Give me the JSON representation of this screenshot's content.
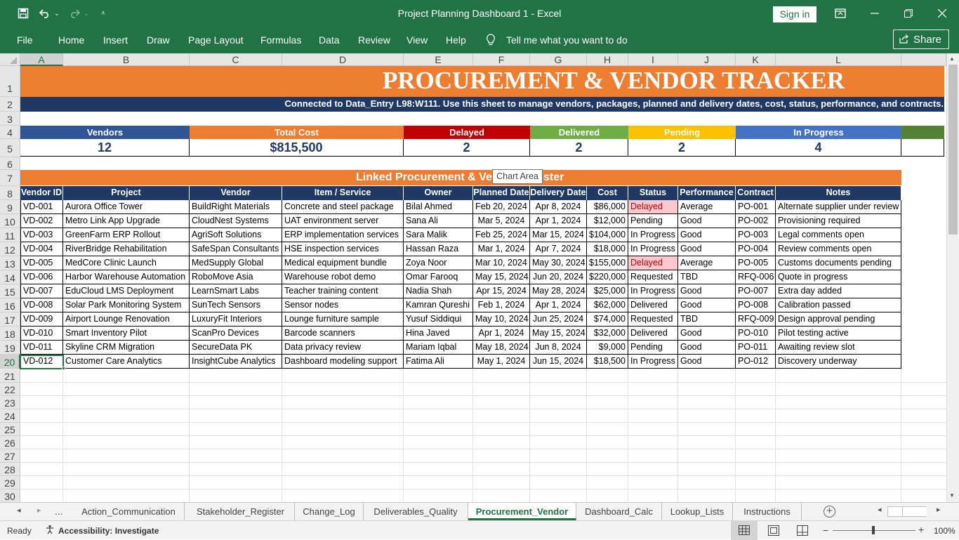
{
  "app": {
    "window_title": "Project Planning Dashboard 1  -  Excel",
    "sign_in": "Sign in",
    "share": "Share",
    "menu": [
      "File",
      "Home",
      "Insert",
      "Draw",
      "Page Layout",
      "Formulas",
      "Data",
      "Review",
      "View",
      "Help"
    ],
    "tell_me": "Tell me what you want to do"
  },
  "columns": [
    "A",
    "B",
    "C",
    "D",
    "E",
    "F",
    "G",
    "H",
    "I",
    "J",
    "K",
    "L"
  ],
  "rows": [
    "1",
    "2",
    "3",
    "4",
    "5",
    "6",
    "7",
    "8",
    "9",
    "10",
    "11",
    "12",
    "13",
    "14",
    "15",
    "16",
    "17",
    "18",
    "19",
    "20",
    "21",
    "22",
    "23",
    "24",
    "25",
    "26",
    "27",
    "28",
    "29",
    "30"
  ],
  "sheet": {
    "title": "PROCUREMENT & VENDOR TRACKER",
    "subtitle": "Connected to Data_Entry L98:W111. Use this sheet to manage vendors, packages, planned and delivery dates, cost, status, performance, and contracts.",
    "kpis": [
      {
        "label": "Vendors",
        "value": "12",
        "color": "#2f5597"
      },
      {
        "label": "Total Cost",
        "value": "$815,500",
        "color": "#ed7d31"
      },
      {
        "label": "Delayed",
        "value": "2",
        "color": "#c00000"
      },
      {
        "label": "Delivered",
        "value": "2",
        "color": "#70ad47"
      },
      {
        "label": "Pending",
        "value": "2",
        "color": "#ffc000"
      },
      {
        "label": "In Progress",
        "value": "4",
        "color": "#4472c4"
      },
      {
        "label": "",
        "value": "",
        "color": "#548235"
      }
    ],
    "register_title_left": "Linked Procurement & Ve",
    "register_title_right": "ster",
    "tooltip": "Chart Area",
    "table_headers": [
      "Vendor ID",
      "Project",
      "Vendor",
      "Item / Service",
      "Owner",
      "Planned Date",
      "Delivery Date",
      "Cost",
      "Status",
      "Performance",
      "Contract",
      "Notes"
    ],
    "table_rows": [
      [
        "VD-001",
        "Aurora Office Tower",
        "BuildRight Materials",
        "Concrete and steel package",
        "Bilal Ahmed",
        "Feb 20, 2024",
        "Apr 8, 2024",
        "$86,000",
        "Delayed",
        "Average",
        "PO-001",
        "Alternate supplier under review"
      ],
      [
        "VD-002",
        "Metro Link App Upgrade",
        "CloudNest Systems",
        "UAT environment server",
        "Sana Ali",
        "Mar 5, 2024",
        "Apr 1, 2024",
        "$12,000",
        "Pending",
        "Good",
        "PO-002",
        "Provisioning required"
      ],
      [
        "VD-003",
        "GreenFarm ERP Rollout",
        "AgriSoft Solutions",
        "ERP implementation services",
        "Sara Malik",
        "Feb 25, 2024",
        "Mar 15, 2024",
        "$104,000",
        "In Progress",
        "Good",
        "PO-003",
        "Legal comments open"
      ],
      [
        "VD-004",
        "RiverBridge Rehabilitation",
        "SafeSpan Consultants",
        "HSE inspection services",
        "Hassan Raza",
        "Mar 1, 2024",
        "Apr 7, 2024",
        "$18,000",
        "In Progress",
        "Good",
        "PO-004",
        "Review comments open"
      ],
      [
        "VD-005",
        "MedCore Clinic Launch",
        "MedSupply Global",
        "Medical equipment bundle",
        "Zoya Noor",
        "Mar 10, 2024",
        "May 30, 2024",
        "$155,000",
        "Delayed",
        "Average",
        "PO-005",
        "Customs documents pending"
      ],
      [
        "VD-006",
        "Harbor Warehouse Automation",
        "RoboMove Asia",
        "Warehouse robot demo",
        "Omar Farooq",
        "May 15, 2024",
        "Jun 20, 2024",
        "$220,000",
        "Requested",
        "TBD",
        "RFQ-006",
        "Quote in progress"
      ],
      [
        "VD-007",
        "EduCloud LMS Deployment",
        "LearnSmart Labs",
        "Teacher training content",
        "Nadia Shah",
        "Apr 15, 2024",
        "May 28, 2024",
        "$25,000",
        "In Progress",
        "Good",
        "PO-007",
        "Extra day added"
      ],
      [
        "VD-008",
        "Solar Park Monitoring System",
        "SunTech Sensors",
        "Sensor nodes",
        "Kamran Qureshi",
        "Feb 1, 2024",
        "Apr 1, 2024",
        "$62,000",
        "Delivered",
        "Good",
        "PO-008",
        "Calibration passed"
      ],
      [
        "VD-009",
        "Airport Lounge Renovation",
        "LuxuryFit Interiors",
        "Lounge furniture sample",
        "Yusuf Siddiqui",
        "May 10, 2024",
        "Jun 25, 2024",
        "$74,000",
        "Requested",
        "TBD",
        "RFQ-009",
        "Design approval pending"
      ],
      [
        "VD-010",
        "Smart Inventory Pilot",
        "ScanPro Devices",
        "Barcode scanners",
        "Hina Javed",
        "Apr 1, 2024",
        "May 15, 2024",
        "$32,000",
        "Delivered",
        "Good",
        "PO-010",
        "Pilot testing active"
      ],
      [
        "VD-011",
        "Skyline CRM Migration",
        "SecureData PK",
        "Data privacy review",
        "Mariam Iqbal",
        "May 18, 2024",
        "Jun 8, 2024",
        "$9,000",
        "Pending",
        "Good",
        "PO-011",
        "Awaiting review slot"
      ],
      [
        "VD-012",
        "Customer Care Analytics",
        "InsightCube Analytics",
        "Dashboard modeling support",
        "Fatima Ali",
        "May 1, 2024",
        "Jun 15, 2024",
        "$18,500",
        "In Progress",
        "Good",
        "PO-012",
        "Discovery underway"
      ]
    ]
  },
  "tabs": {
    "ellipsis": "...",
    "items": [
      "Action_Communication",
      "Stakeholder_Register",
      "Change_Log",
      "Deliverables_Quality",
      "Procurement_Vendor",
      "Dashboard_Calc",
      "Lookup_Lists",
      "Instructions"
    ],
    "active": "Procurement_Vendor"
  },
  "status": {
    "ready": "Ready",
    "accessibility": "Accessibility: Investigate",
    "zoom": "100%"
  },
  "colors": {
    "excel_green": "#217346",
    "title_orange": "#ed7d31",
    "header_navy": "#1f3864",
    "delayed_fill": "#ffc7ce",
    "delayed_text": "#c00000"
  }
}
